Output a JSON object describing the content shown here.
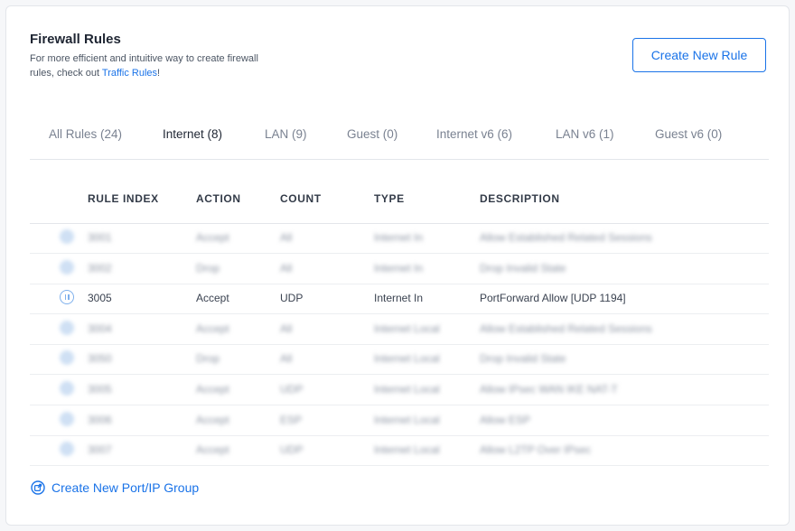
{
  "header": {
    "title": "Firewall Rules",
    "subtitle_text": "For more efficient and intuitive way to create firewall rules, check out ",
    "subtitle_link": "Traffic Rules",
    "subtitle_end": "!",
    "create_rule_label": "Create New Rule"
  },
  "tabs": [
    {
      "label": "All Rules (24)",
      "active": false
    },
    {
      "label": "Internet (8)",
      "active": true
    },
    {
      "label": "LAN (9)",
      "active": false
    },
    {
      "label": "Guest (0)",
      "active": false
    },
    {
      "label": "Internet v6 (6)",
      "active": false
    },
    {
      "label": "LAN v6 (1)",
      "active": false
    },
    {
      "label": "Guest v6 (0)",
      "active": false
    }
  ],
  "table": {
    "columns": [
      "RULE INDEX",
      "ACTION",
      "COUNT",
      "TYPE",
      "DESCRIPTION"
    ],
    "rows": [
      {
        "index": "3001",
        "action": "Accept",
        "count": "All",
        "type": "Internet In",
        "description": "Allow Established Related Sessions",
        "blurred": true,
        "icon": "rule-icon"
      },
      {
        "index": "3002",
        "action": "Drop",
        "count": "All",
        "type": "Internet In",
        "description": "Drop Invalid State",
        "blurred": true,
        "icon": "rule-icon"
      },
      {
        "index": "3005",
        "action": "Accept",
        "count": "UDP",
        "type": "Internet In",
        "description": "PortForward Allow [UDP 1194]",
        "blurred": false,
        "icon": "pause-icon"
      },
      {
        "index": "3004",
        "action": "Accept",
        "count": "All",
        "type": "Internet Local",
        "description": "Allow Established Related Sessions",
        "blurred": true,
        "icon": "rule-icon"
      },
      {
        "index": "3050",
        "action": "Drop",
        "count": "All",
        "type": "Internet Local",
        "description": "Drop Invalid State",
        "blurred": true,
        "icon": "rule-icon"
      },
      {
        "index": "3005",
        "action": "Accept",
        "count": "UDP",
        "type": "Internet Local",
        "description": "Allow IPsec WAN IKE NAT-T",
        "blurred": true,
        "icon": "rule-icon"
      },
      {
        "index": "3006",
        "action": "Accept",
        "count": "ESP",
        "type": "Internet Local",
        "description": "Allow ESP",
        "blurred": true,
        "icon": "rule-icon"
      },
      {
        "index": "3007",
        "action": "Accept",
        "count": "UDP",
        "type": "Internet Local",
        "description": "Allow L2TP Over IPsec",
        "blurred": true,
        "icon": "rule-icon"
      }
    ]
  },
  "footer": {
    "group_link_label": "Create New Port/IP Group",
    "icon": "external-link-icon"
  },
  "colors": {
    "accent": "#1a73e8",
    "text": "#2b3240",
    "muted": "#7a8291"
  }
}
